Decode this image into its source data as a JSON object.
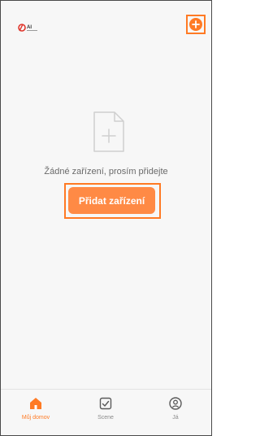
{
  "header": {
    "logo_text": "AI",
    "add_icon": "plus-circle-icon"
  },
  "empty_state": {
    "icon": "blank-document-plus-icon",
    "message": "Žádné zařízení, prosím přidejte",
    "button_label": "Přidat zařízení"
  },
  "tabs": [
    {
      "label": "Můj domov",
      "icon": "home-icon",
      "active": true
    },
    {
      "label": "Scene",
      "icon": "checkbox-icon",
      "active": false
    },
    {
      "label": "Já",
      "icon": "user-icon",
      "active": false
    }
  ],
  "colors": {
    "accent": "#ff7a24",
    "button": "#ff8a45",
    "background": "#f7f7f7"
  }
}
